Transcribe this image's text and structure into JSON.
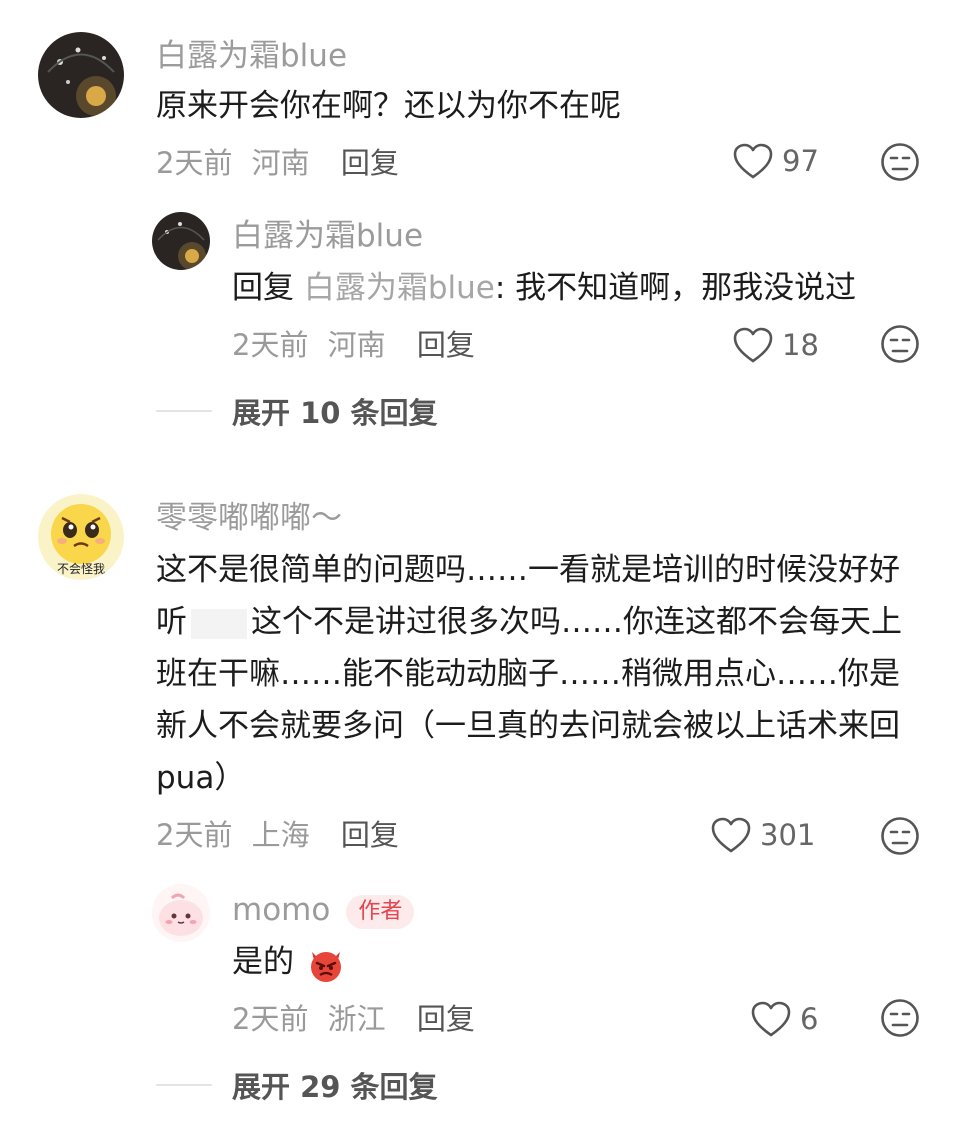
{
  "comments": [
    {
      "username": "白露为霜blue",
      "text": "原来开会你在啊？还以为你不在呢",
      "time": "2天前",
      "location": "河南",
      "reply_label": "回复",
      "likes": "97",
      "reply": {
        "username": "白露为霜blue",
        "prefix": "回复",
        "reply_to": "白露为霜blue",
        "text": ": 我不知道啊，那我没说过",
        "time": "2天前",
        "location": "河南",
        "reply_label": "回复",
        "likes": "18"
      },
      "expand_label": "展开 10 条回复"
    },
    {
      "username": "零零嘟嘟嘟～",
      "avatar_text": "不会怪我",
      "text_part1": "这不是很简单的问题吗……一看就是培训的时候没好好听",
      "text_part2": "这个不是讲过很多次吗……你连这都不会每天上班在干嘛……能不能动动脑子……稍微用点心……你是新人不会就要多问（一旦真的去问就会被以上话术来回pua）",
      "time": "2天前",
      "location": "上海",
      "reply_label": "回复",
      "likes": "301",
      "reply": {
        "username": "momo",
        "author_tag": "作者",
        "text": "是的",
        "time": "2天前",
        "location": "浙江",
        "reply_label": "回复",
        "likes": "6"
      },
      "expand_label": "展开 29 条回复"
    }
  ],
  "colors": {
    "author_tag_bg": "#fdeaea",
    "author_tag_text": "#e5454e",
    "meta": "#9a9a9a"
  },
  "icons": {
    "like": "heart-outline-icon",
    "dislike": "neutral-face-icon",
    "emoji": "angry-devil-emoji"
  }
}
